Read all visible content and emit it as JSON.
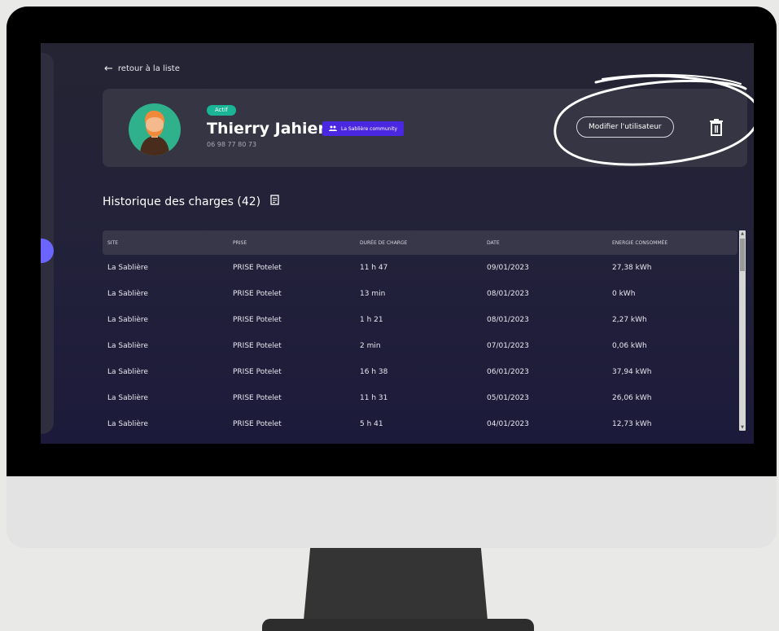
{
  "back_link": {
    "label": "retour à la liste"
  },
  "profile": {
    "status": "Actif",
    "name": "Thierry Jahier",
    "phone": "06 98 77 80 73",
    "community": "La Sablière community",
    "edit_button": "Modifier l'utilisateur",
    "delete_icon": "trash-icon"
  },
  "history": {
    "title": "Historique des charges (42)",
    "columns": [
      "SITE",
      "PRISE",
      "DURÉE DE CHARGE",
      "DATE",
      "ENERGIE CONSOMMÉE"
    ],
    "rows": [
      [
        "La Sablière",
        "PRISE Potelet",
        "11 h 47",
        "09/01/2023",
        "27,38 kWh"
      ],
      [
        "La Sablière",
        "PRISE Potelet",
        "13 min",
        "08/01/2023",
        "0 kWh"
      ],
      [
        "La Sablière",
        "PRISE Potelet",
        "1 h 21",
        "08/01/2023",
        "2,27 kWh"
      ],
      [
        "La Sablière",
        "PRISE Potelet",
        "2 min",
        "07/01/2023",
        "0,06 kWh"
      ],
      [
        "La Sablière",
        "PRISE Potelet",
        "16 h 38",
        "06/01/2023",
        "37,94 kWh"
      ],
      [
        "La Sablière",
        "PRISE Potelet",
        "11 h 31",
        "05/01/2023",
        "26,06 kWh"
      ],
      [
        "La Sablière",
        "PRISE Potelet",
        "5 h 41",
        "04/01/2023",
        "12,73 kWh"
      ]
    ]
  },
  "colors": {
    "status_green": "#19b596",
    "community_purple": "#4a27e0",
    "sidebar_accent": "#6b64ff"
  }
}
